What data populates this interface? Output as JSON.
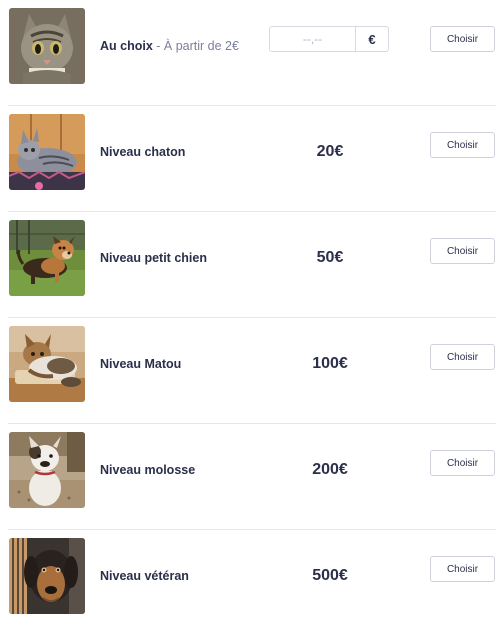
{
  "tiers": [
    {
      "title": "Au choix",
      "subtitle": " - À partir de 2€",
      "custom_amount": {
        "placeholder": "--,--",
        "currency": "€"
      },
      "button_label": "Choisir",
      "image": "tabby-cat-photo"
    },
    {
      "title": "Niveau chaton",
      "price": "20€",
      "button_label": "Choisir",
      "image": "grey-kitten-photo"
    },
    {
      "title": "Niveau petit chien",
      "price": "50€",
      "button_label": "Choisir",
      "image": "small-dog-on-grass-photo"
    },
    {
      "title": "Niveau Matou",
      "price": "100€",
      "button_label": "Choisir",
      "image": "cats-lying-photo"
    },
    {
      "title": "Niveau molosse",
      "price": "200€",
      "button_label": "Choisir",
      "image": "white-bulldog-photo"
    },
    {
      "title": "Niveau vétéran",
      "price": "500€",
      "button_label": "Choisir",
      "image": "old-dog-photo"
    }
  ]
}
